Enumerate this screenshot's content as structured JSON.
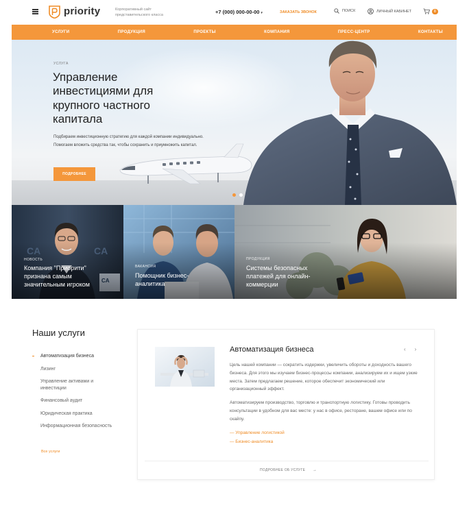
{
  "header": {
    "logo_text": "priority",
    "tagline": "Корпоративный сайт представительского класса",
    "phone": "+7 (000) 000-00-00",
    "callback": "ЗАКАЗАТЬ ЗВОНОК",
    "search": "ПОИСК",
    "cabinet": "ЛИЧНЫЙ КАБИНЕТ",
    "cart_count": "0"
  },
  "nav": {
    "items": [
      {
        "label": "УСЛУГИ"
      },
      {
        "label": "ПРОДУКЦИЯ"
      },
      {
        "label": "ПРОЕКТЫ"
      },
      {
        "label": "КОМПАНИЯ"
      },
      {
        "label": "ПРЕСС-ЦЕНТР"
      },
      {
        "label": "КОНТАКТЫ"
      }
    ]
  },
  "hero": {
    "overline": "УСЛУГА",
    "title": "Управление инвестициями для крупного частного капитала",
    "description": "Подбираем инвестиционную стратегию для каждой компании индивидуально. Помогаем вложить средства так, чтобы сохранить и приумножить капитал.",
    "button": "ПОДРОБНЕЕ"
  },
  "tiles": [
    {
      "category": "НОВОСТЬ",
      "title": "Компания \"Приорити\" признана самым значительным игроком"
    },
    {
      "category": "ВАКАНСИЯ",
      "title": "Помощник бизнес-аналитика"
    },
    {
      "category": "ПРОДУКЦИЯ",
      "title": "Системы безопасных платежей для онлайн-коммерции"
    }
  ],
  "services": {
    "heading": "Наши услуги",
    "items": [
      {
        "label": "Автоматизация бизнеса"
      },
      {
        "label": "Лизинг"
      },
      {
        "label": "Управление активами и инвестиции"
      },
      {
        "label": "Финансовый аудит"
      },
      {
        "label": "Юридическая практика"
      },
      {
        "label": "Информационная безопасность"
      }
    ],
    "all_link": "Все услуги"
  },
  "service_card": {
    "title": "Автоматизация бизнеса",
    "paragraph1": "Цель нашей компании — сократить издержки, увеличить обороты и доходность вашего бизнеса. Для этого мы изучаем бизнес-процессы компании, анализируем их и ищем узкие места. Затем предлагаем решение, которое обеспечит экономический или организационный эффект.",
    "paragraph2": "Автоматизируем производство, торговлю и транспортную логистику. Готовы проводить консультации в удобном для вас месте: у нас в офисе, ресторане, вашем офисе или по скайпу.",
    "link1": "— Управление логистикой",
    "link2": "— Бизнес-аналитика",
    "more": "ПОДРОБНЕЕ ОБ УСЛУГЕ",
    "more_arrow": "→",
    "prev": "‹",
    "next": "›"
  },
  "colors": {
    "accent": "#f4973b",
    "accent_text": "#ef8c26"
  }
}
